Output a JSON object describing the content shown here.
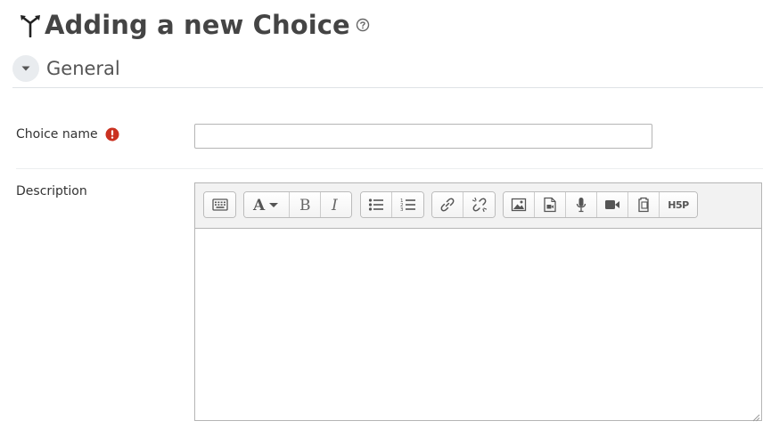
{
  "page": {
    "title": "Adding a new Choice"
  },
  "section": {
    "title": "General"
  },
  "form": {
    "choice_name": {
      "label": "Choice name",
      "value": "",
      "placeholder": ""
    },
    "description": {
      "label": "Description",
      "value": ""
    }
  },
  "toolbar": {
    "groups": [
      [
        "show-more-buttons-icon"
      ],
      [
        "font-style-icon",
        "bold-icon",
        "italic-icon"
      ],
      [
        "unordered-list-icon",
        "ordered-list-icon"
      ],
      [
        "link-icon",
        "unlink-icon"
      ],
      [
        "insert-image-icon",
        "insert-media-icon",
        "record-audio-icon",
        "record-video-icon",
        "manage-files-icon",
        "h5p-icon"
      ]
    ],
    "h5p_label": "H5P"
  },
  "icons": {
    "module": "choice-signpost-icon",
    "help": "help-question-icon",
    "collapse": "chevron-down-icon",
    "required": "required-exclamation-icon"
  },
  "colors": {
    "heading": "#444444",
    "required": "#ca3120",
    "border": "#b5b5b5",
    "toolbar_bg": "#f2f2f2",
    "icon": "#666666"
  }
}
